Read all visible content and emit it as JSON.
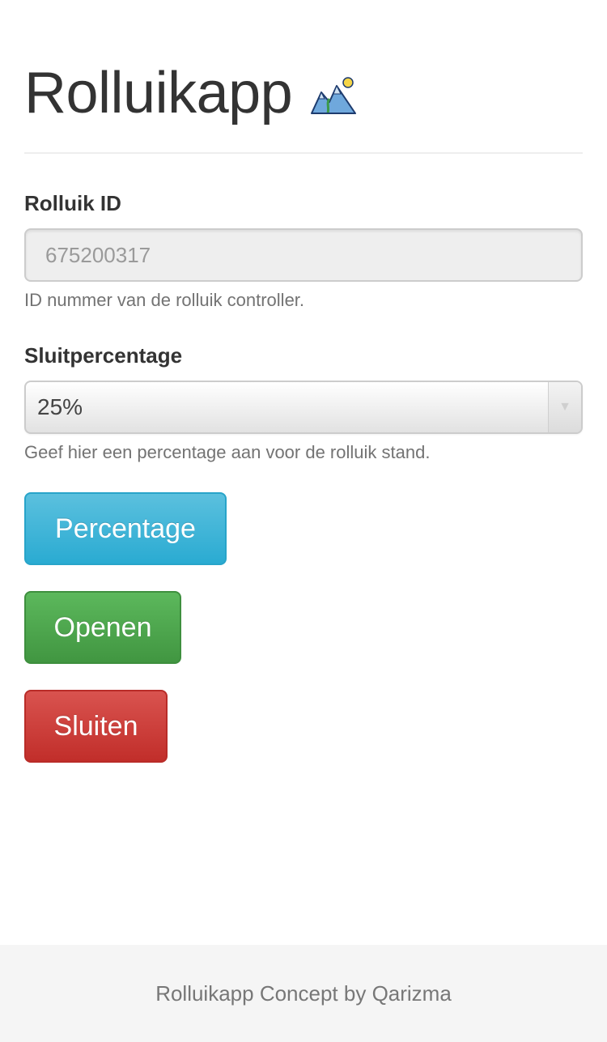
{
  "header": {
    "title": "Rolluikapp",
    "icon": "mountain-landscape-icon"
  },
  "form": {
    "id_field": {
      "label": "Rolluik ID",
      "placeholder": "675200317",
      "value": "",
      "help": "ID nummer van de rolluik controller."
    },
    "percentage_field": {
      "label": "Sluitpercentage",
      "selected": "25%",
      "help": "Geef hier een percentage aan voor de rolluik stand."
    }
  },
  "buttons": {
    "percentage": "Percentage",
    "open": "Openen",
    "close": "Sluiten"
  },
  "colors": {
    "info": "#5bc0de",
    "success": "#5cb85c",
    "danger": "#d9534f"
  },
  "footer": {
    "text": "Rolluikapp Concept by Qarizma"
  }
}
